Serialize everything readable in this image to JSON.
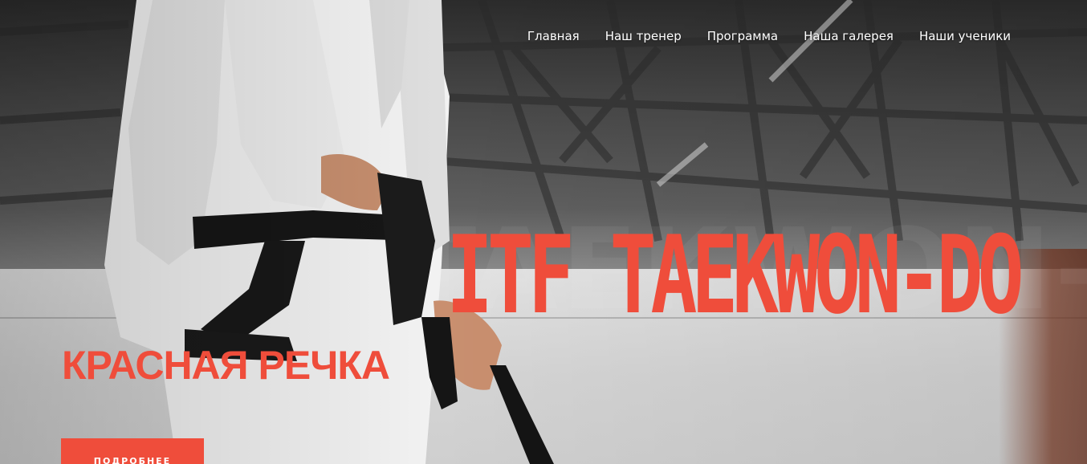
{
  "nav": {
    "items": [
      {
        "label": "Главная"
      },
      {
        "label": "Наш тренер"
      },
      {
        "label": "Программа"
      },
      {
        "label": "Наша галерея"
      },
      {
        "label": "Наши ученики"
      }
    ]
  },
  "hero": {
    "title": "ITF TAEKWON-DO",
    "subtitle": "КРАСНАЯ РЕЧКА",
    "cta_label": "ПОДРОБНЕЕ"
  },
  "colors": {
    "accent": "#ef4d3b",
    "nav_text": "#ffffff"
  }
}
